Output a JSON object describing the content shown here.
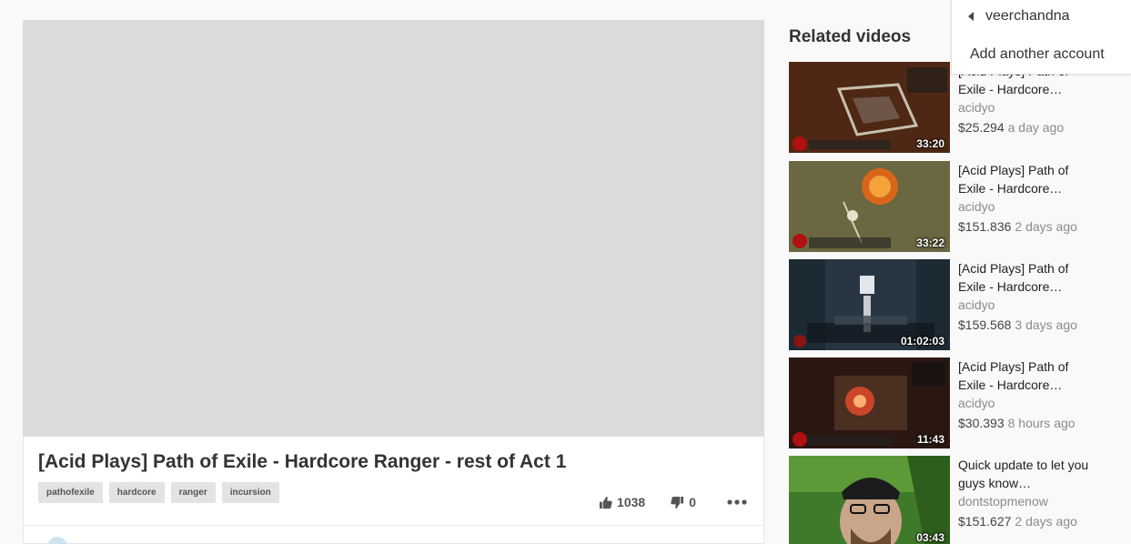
{
  "video": {
    "title": "[Acid Plays] Path of Exile - Hardcore Ranger - rest of Act 1",
    "tags": [
      "pathofexile",
      "hardcore",
      "ranger",
      "incursion"
    ],
    "likes": "1038",
    "dislikes": "0"
  },
  "related": {
    "heading": "Related videos",
    "items": [
      {
        "title": "[Acid Plays] Path of Exile - Hardcore…",
        "channel": "acidyo",
        "payout": "$25.294",
        "age": "a day ago",
        "duration": "33:20"
      },
      {
        "title": "[Acid Plays] Path of Exile - Hardcore…",
        "channel": "acidyo",
        "payout": "$151.836",
        "age": "2 days ago",
        "duration": "33:22"
      },
      {
        "title": "[Acid Plays] Path of Exile - Hardcore…",
        "channel": "acidyo",
        "payout": "$159.568",
        "age": "3 days ago",
        "duration": "01:02:03"
      },
      {
        "title": "[Acid Plays] Path of Exile - Hardcore…",
        "channel": "acidyo",
        "payout": "$30.393",
        "age": "8 hours ago",
        "duration": "11:43"
      },
      {
        "title": "Quick update to let you guys know…",
        "channel": "dontstopmenow",
        "payout": "$151.627",
        "age": "2 days ago",
        "duration": "03:43"
      }
    ]
  },
  "account_menu": {
    "username": "veerchandna",
    "add_account": "Add another account"
  },
  "icons": {
    "back": "caret-left-icon",
    "like": "thumbs-up-icon",
    "dislike": "thumbs-down-icon",
    "more": "more-horizontal-icon"
  },
  "colors": {
    "player_bg": "#dcdcde",
    "page_bg": "#f9f9f9",
    "tag_bg": "#e3e3e3"
  }
}
